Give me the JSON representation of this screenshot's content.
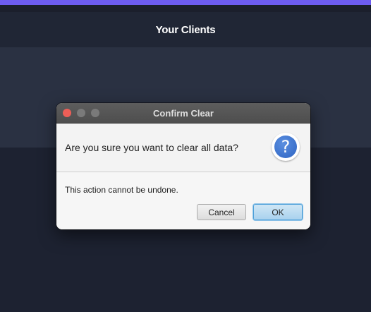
{
  "app": {
    "header_title": "Your Clients",
    "accent_color": "#6d5cf0"
  },
  "dialog": {
    "title": "Confirm Clear",
    "header_text": "Are you sure you want to clear all data?",
    "icon": "question-icon",
    "icon_glyph": "?",
    "content_text": "This action cannot be undone.",
    "buttons": {
      "cancel": "Cancel",
      "ok": "OK"
    }
  }
}
